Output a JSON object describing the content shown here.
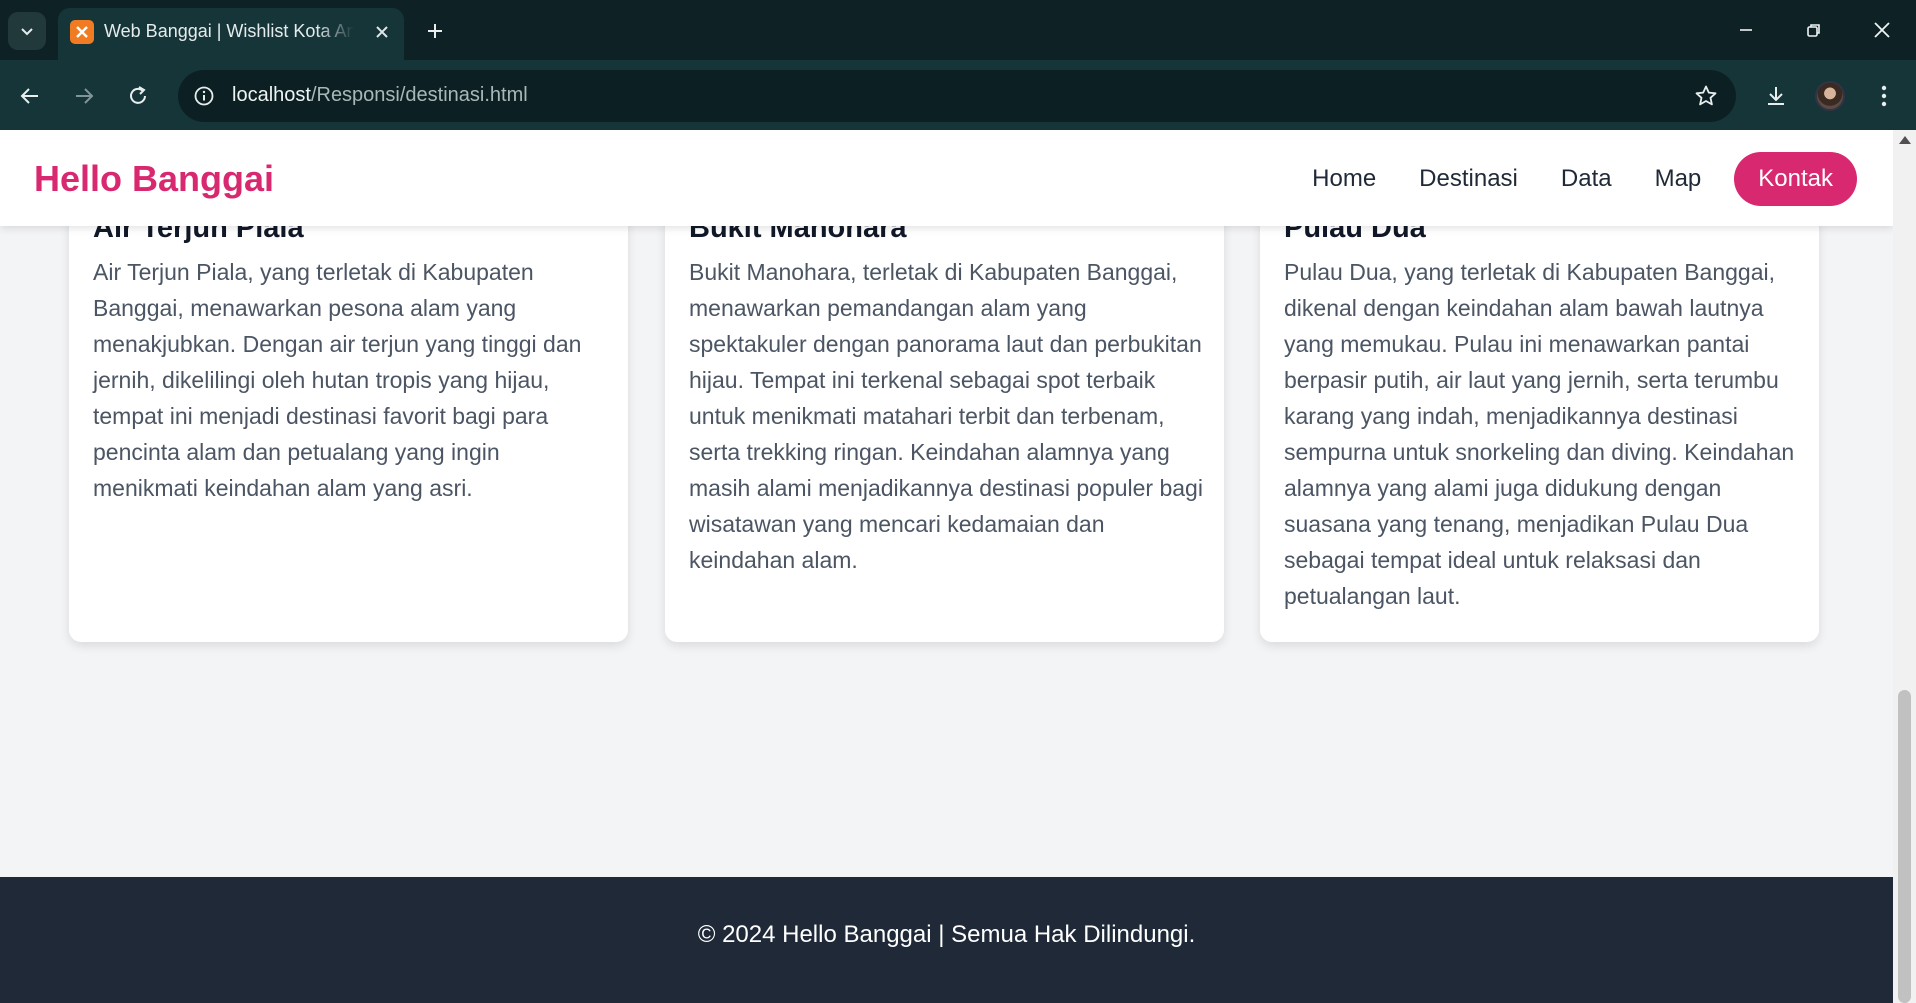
{
  "browser": {
    "tab_title": "Web Banggai | Wishlist Kota Anda",
    "url_host": "localhost",
    "url_path": "/Responsi/destinasi.html"
  },
  "site": {
    "brand": "Hello Banggai",
    "menu": [
      "Home",
      "Destinasi",
      "Data",
      "Map"
    ],
    "cta": "Kontak"
  },
  "cards": [
    {
      "title": "Air Terjun Piala",
      "text": "Air Terjun Piala, yang terletak di Kabupaten Banggai, menawarkan pesona alam yang menakjubkan. Dengan air terjun yang tinggi dan jernih, dikelilingi oleh hutan tropis yang hijau, tempat ini menjadi destinasi favorit bagi para pencinta alam dan petualang yang ingin menikmati keindahan alam yang asri."
    },
    {
      "title": "Bukit Manohara",
      "text": "Bukit Manohara, terletak di Kabupaten Banggai, menawarkan pemandangan alam yang spektakuler dengan panorama laut dan perbukitan hijau. Tempat ini terkenal sebagai spot terbaik untuk menikmati matahari terbit dan terbenam, serta trekking ringan. Keindahan alamnya yang masih alami menjadikannya destinasi populer bagi wisatawan yang mencari kedamaian dan keindahan alam."
    },
    {
      "title": "Pulau Dua",
      "text": "Pulau Dua, yang terletak di Kabupaten Banggai, dikenal dengan keindahan alam bawah lautnya yang memukau. Pulau ini menawarkan pantai berpasir putih, air laut yang jernih, serta terumbu karang yang indah, menjadikannya destinasi sempurna untuk snorkeling dan diving. Keindahan alamnya yang alami juga didukung dengan suasana yang tenang, menjadikan Pulau Dua sebagai tempat ideal untuk relaksasi dan petualangan laut."
    }
  ],
  "footer": {
    "text": "© 2024 Hello Banggai | Semua Hak Dilindungi."
  },
  "colors": {
    "brand": "#d8286f",
    "footer_bg": "#1f2937",
    "browser_bg": "#163539"
  }
}
